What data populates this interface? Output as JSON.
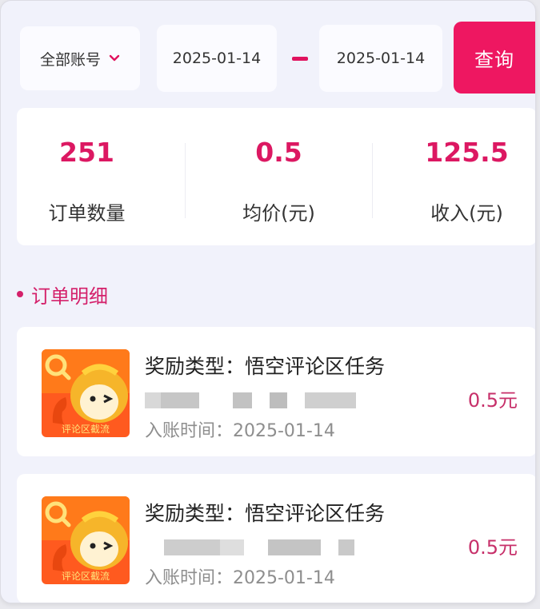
{
  "filter": {
    "account_label": "全部账号",
    "start_date": "2025-01-14",
    "end_date": "2025-01-14",
    "query_label": "查询"
  },
  "stats": {
    "order_count": {
      "value": "251",
      "label": "订单数量"
    },
    "avg_price": {
      "value": "0.5",
      "label": "均价(元)"
    },
    "income": {
      "value": "125.5",
      "label": "收入(元)"
    }
  },
  "section": {
    "title": "订单明细"
  },
  "orders": [
    {
      "reward_type": "奖励类型：悟空评论区任务",
      "time": "入账时间：2025-01-14",
      "amount": "0.5元",
      "thumb_text": "评论区截流"
    },
    {
      "reward_type": "奖励类型：悟空评论区任务",
      "time": "入账时间：2025-01-14",
      "amount": "0.5元",
      "thumb_text": "评论区截流"
    }
  ],
  "colors": {
    "accent": "#ee1761",
    "stat_value": "#dc1862",
    "section": "#d4206a",
    "amount": "#c7306a"
  },
  "icons": {
    "account_dropdown": "chevron-down-icon",
    "thumb": "wukong-comment-task-icon"
  }
}
